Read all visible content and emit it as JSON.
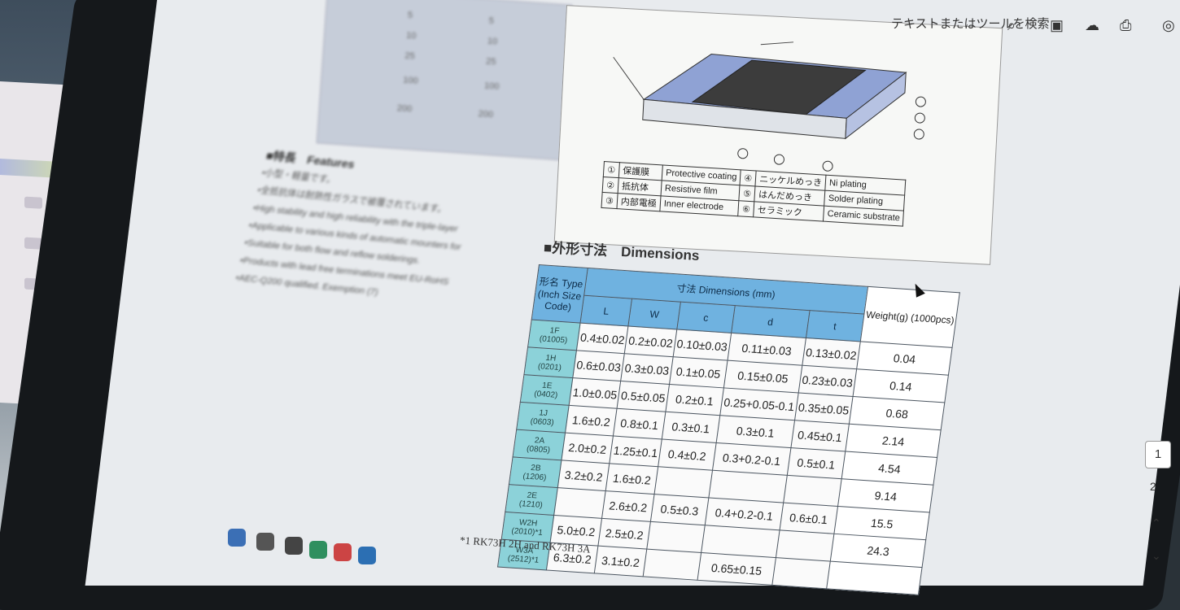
{
  "toolbar": {
    "search_label": "テキストまたはツールを検索",
    "icons": [
      "search-icon",
      "save-icon",
      "upload-icon",
      "print-icon",
      "account-icon"
    ]
  },
  "blurred_text": {
    "features_heading": "■特長　Features",
    "lines": [
      "•小型・軽量です。",
      "•全抵抗体は耐熱性ガラスで被覆されています。",
      "•High stability and high reliability with the triple-layer",
      "•Applicable to various kinds of automatic mounters for",
      "•Suitable for both flow and reflow solderings.",
      "•Products with lead free terminations meet EU-RoHS",
      "•AEC-Q200 qualified. Exemption (7)"
    ]
  },
  "legend": {
    "rows": [
      {
        "num": "①",
        "jp": "保護膜",
        "en": "Protective coating",
        "num2": "④",
        "jp2": "ニッケルめっき",
        "en2": "Ni plating"
      },
      {
        "num": "②",
        "jp": "抵抗体",
        "en": "Resistive film",
        "num2": "⑤",
        "jp2": "はんだめっき",
        "en2": "Solder plating"
      },
      {
        "num": "③",
        "jp": "内部電極",
        "en": "Inner electrode",
        "num2": "⑥",
        "jp2": "セラミック",
        "en2": "Ceramic substrate"
      }
    ]
  },
  "dimensions": {
    "title": "■外形寸法　Dimensions",
    "type_header": "形名 Type (Inch Size Code)",
    "dims_header": "寸法 Dimensions (mm)",
    "weight_header": "Weight(g) (1000pcs)",
    "cols": [
      "L",
      "W",
      "c",
      "d",
      "t"
    ],
    "rows": [
      {
        "type": "1F",
        "code": "(01005)",
        "L": "0.4±0.02",
        "W": "0.2±0.02",
        "c": "0.10±0.03",
        "d": "0.11±0.03",
        "t": "0.13±0.02",
        "wt": "0.04"
      },
      {
        "type": "1H",
        "code": "(0201)",
        "L": "0.6±0.03",
        "W": "0.3±0.03",
        "c": "0.1±0.05",
        "d": "0.15±0.05",
        "t": "0.23±0.03",
        "wt": "0.14"
      },
      {
        "type": "1E",
        "code": "(0402)",
        "L": "1.0±0.05",
        "W": "0.5±0.05",
        "c": "0.2±0.1",
        "d": "0.25+0.05-0.1",
        "t": "0.35±0.05",
        "wt": "0.68"
      },
      {
        "type": "1J",
        "code": "(0603)",
        "L": "1.6±0.2",
        "W": "0.8±0.1",
        "c": "0.3±0.1",
        "d": "0.3±0.1",
        "t": "0.45±0.1",
        "wt": "2.14"
      },
      {
        "type": "2A",
        "code": "(0805)",
        "L": "2.0±0.2",
        "W": "1.25±0.1",
        "c": "0.4±0.2",
        "d": "0.3+0.2-0.1",
        "t": "0.5±0.1",
        "wt": "4.54"
      },
      {
        "type": "2B",
        "code": "(1206)",
        "L": "3.2±0.2",
        "W": "1.6±0.2",
        "c": "",
        "d": "",
        "t": "",
        "wt": "9.14"
      },
      {
        "type": "2E",
        "code": "(1210)",
        "L": "",
        "W": "2.6±0.2",
        "c": "0.5±0.3",
        "d": "0.4+0.2-0.1",
        "t": "0.6±0.1",
        "wt": "15.5"
      },
      {
        "type": "W2H",
        "code": "(2010)*1",
        "L": "5.0±0.2",
        "W": "2.5±0.2",
        "c": "",
        "d": "",
        "t": "",
        "wt": "24.3"
      },
      {
        "type": "W3A",
        "code": "(2512)*1",
        "L": "6.3±0.2",
        "W": "3.1±0.2",
        "c": "",
        "d": "0.65±0.15",
        "t": "",
        "wt": ""
      }
    ]
  },
  "footnote": "*1  RK73H 2H and RK73H 3A",
  "pages": [
    "1",
    "2"
  ]
}
